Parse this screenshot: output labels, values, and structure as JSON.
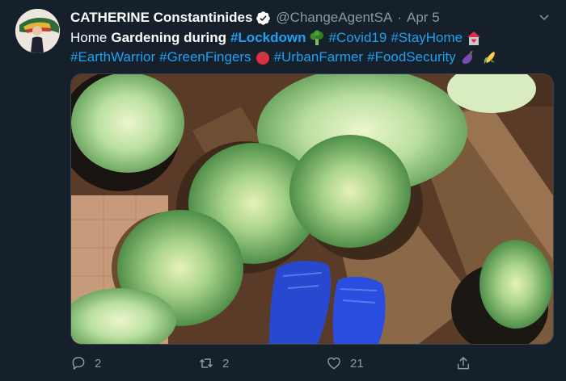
{
  "tweet": {
    "author_name": "CATHERINE Constantinides",
    "handle": "@ChangeAgentSA",
    "separator": "·",
    "time": "Apr 5",
    "line1": {
      "word1": "Home",
      "bold_text": "Gardening during",
      "tag1": "#Lockdown",
      "tag2": "#Covid19",
      "tag3": "#StayHome"
    },
    "line2": {
      "tag1": "#EarthWarrior",
      "tag2": "#GreenFingers",
      "tag3": "#UrbanFarmer",
      "tag4": "#FoodSecurity"
    }
  },
  "actions": {
    "reply_count": "2",
    "retweet_count": "2",
    "like_count": "21"
  },
  "colors": {
    "background": "#15202b",
    "link": "#1da1f2",
    "muted": "#8899a6",
    "verified": "#ffffff"
  },
  "icons": [
    "verified-icon",
    "chevron-down-icon",
    "broccoli-emoji",
    "house-emoji",
    "tomato-emoji",
    "eggplant-emoji",
    "corn-emoji",
    "reply-icon",
    "retweet-icon",
    "like-icon",
    "share-icon"
  ]
}
